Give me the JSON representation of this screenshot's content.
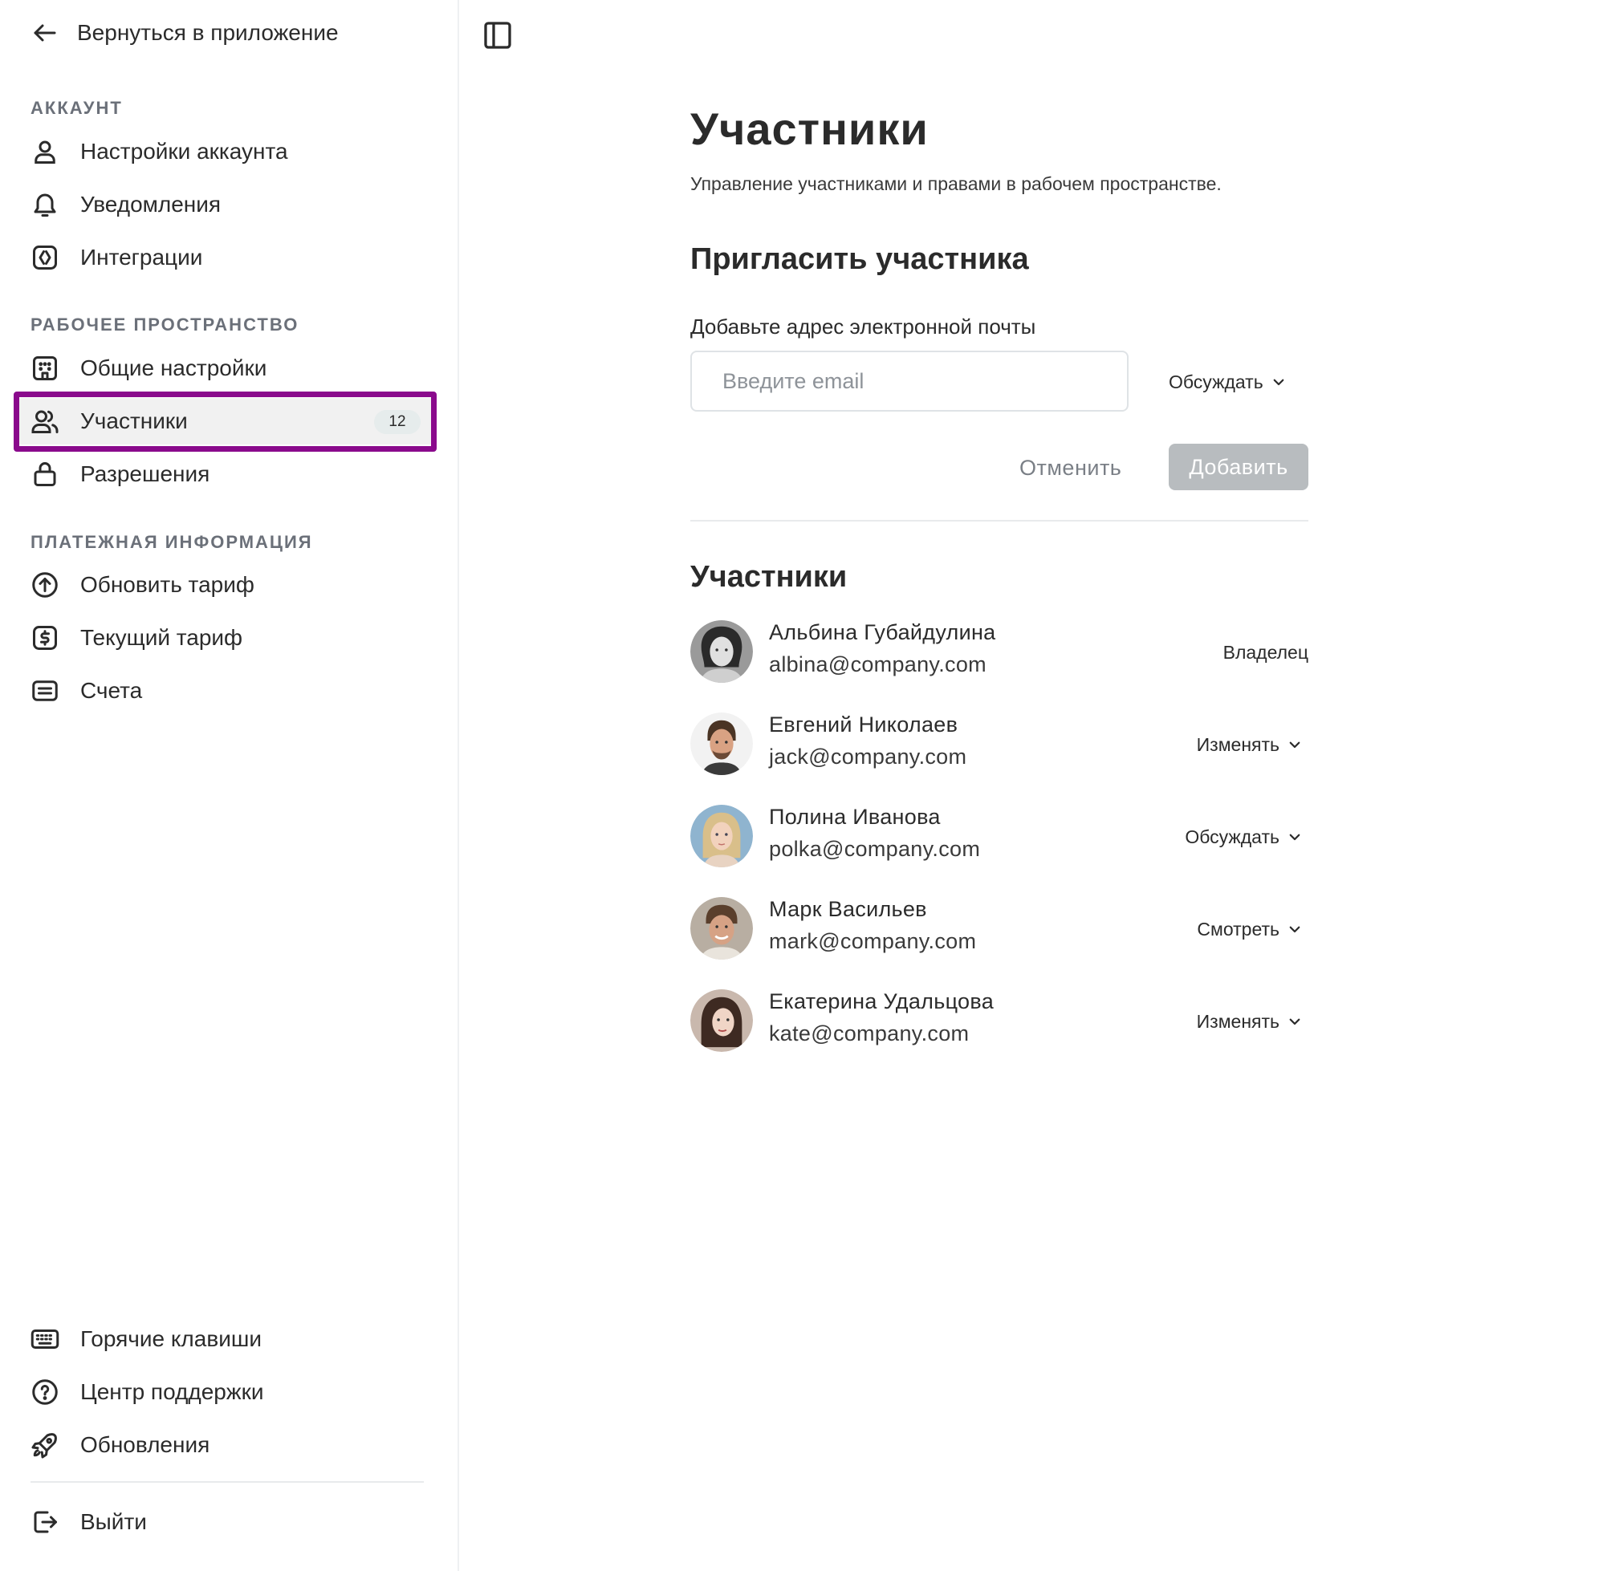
{
  "sidebar": {
    "back_label": "Вернуться в приложение",
    "sections": [
      {
        "title": "АККАУНТ"
      },
      {
        "title": "РАБОЧЕЕ ПРОСТРАНСТВО"
      },
      {
        "title": "ПЛАТЕЖНАЯ ИНФОРМАЦИЯ"
      }
    ],
    "items": [
      {
        "label": "Настройки аккаунта",
        "icon": "user-icon"
      },
      {
        "label": "Уведомления",
        "icon": "bell-icon"
      },
      {
        "label": "Интеграции",
        "icon": "integrations-icon"
      },
      {
        "label": "Общие настройки",
        "icon": "building-icon"
      },
      {
        "label": "Участники",
        "icon": "users-icon",
        "badge": "12",
        "active": true
      },
      {
        "label": "Разрешения",
        "icon": "lock-icon"
      },
      {
        "label": "Обновить тариф",
        "icon": "arrow-up-circle-icon"
      },
      {
        "label": "Текущий тариф",
        "icon": "dollar-icon"
      },
      {
        "label": "Счета",
        "icon": "invoice-icon"
      }
    ],
    "footer_items": [
      {
        "label": "Горячие клавиши",
        "icon": "keyboard-icon"
      },
      {
        "label": "Центр поддержки",
        "icon": "help-icon"
      },
      {
        "label": "Обновления",
        "icon": "rocket-icon"
      }
    ],
    "logout_label": "Выйти"
  },
  "main": {
    "title": "Участники",
    "subtitle": "Управление участниками и правами в рабочем пространстве.",
    "invite": {
      "title": "Пригласить участника",
      "email_label": "Добавьте адрес электронной почты",
      "email_placeholder": "Введите email",
      "email_value": "",
      "role": "Обсуждать",
      "cancel_label": "Отменить",
      "add_label": "Добавить"
    },
    "members_title": "Участники",
    "members": [
      {
        "name": "Альбина Губайдулина",
        "email": "albina@company.com",
        "role": "Владелец",
        "editable": false
      },
      {
        "name": "Евгений Николаев",
        "email": "jack@company.com",
        "role": "Изменять",
        "editable": true
      },
      {
        "name": "Полина Иванова",
        "email": "polka@company.com",
        "role": "Обсуждать",
        "editable": true
      },
      {
        "name": "Марк Васильев",
        "email": "mark@company.com",
        "role": "Смотреть",
        "editable": true
      },
      {
        "name": "Екатерина Удальцова",
        "email": "kate@company.com",
        "role": "Изменять",
        "editable": true
      }
    ]
  },
  "colors": {
    "highlight": "#8a0a8c",
    "badge_bg": "#e6ecec",
    "add_button_disabled": "#b8bcbf",
    "section_title": "#6b7079"
  }
}
